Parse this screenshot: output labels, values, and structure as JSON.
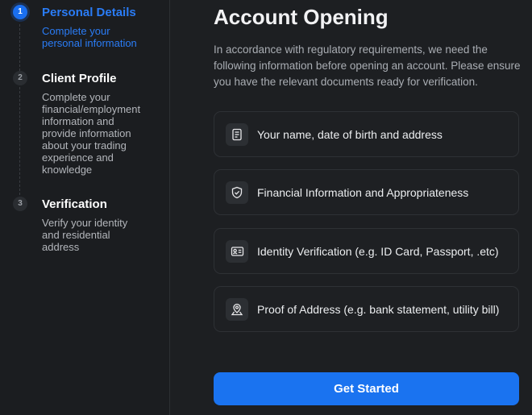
{
  "steps": [
    {
      "number": "1",
      "title": "Personal Details",
      "desc": "Complete your personal information"
    },
    {
      "number": "2",
      "title": "Client Profile",
      "desc": "Complete your financial/employment information and provide information about your trading experience and knowledge"
    },
    {
      "number": "3",
      "title": "Verification",
      "desc": "Verify your identity and residential address"
    }
  ],
  "main": {
    "title": "Account Opening",
    "intro": "In accordance with regulatory requirements, we need the following information before opening an account. Please ensure you have the relevant documents ready for verification.",
    "items": [
      {
        "icon": "document-icon",
        "label": "Your name, date of birth and address"
      },
      {
        "icon": "shield-check-icon",
        "label": "Financial Information and Appropriateness"
      },
      {
        "icon": "id-card-icon",
        "label": "Identity Verification (e.g. ID Card, Passport, .etc)"
      },
      {
        "icon": "location-pin-icon",
        "label": "Proof of Address (e.g. bank statement, utility bill)"
      }
    ],
    "cta_label": "Get Started"
  },
  "colors": {
    "accent": "#1a73f0",
    "background": "#1d1f22",
    "active_step": "#2a7cf6"
  }
}
